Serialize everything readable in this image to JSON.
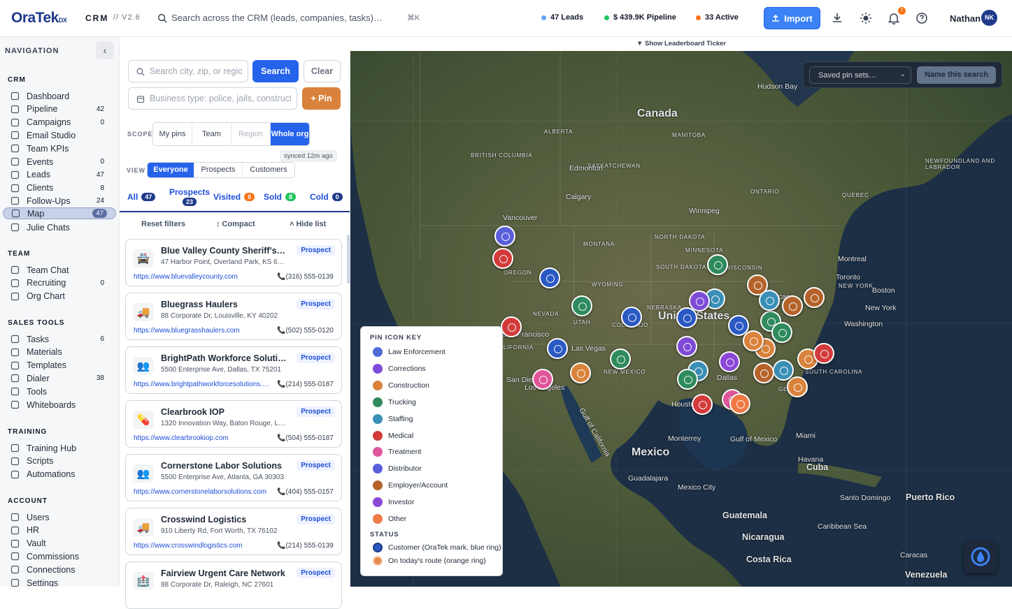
{
  "app": {
    "logo": "OraTek",
    "logo_suffix": "DX",
    "module": "CRM",
    "version": "// V2.6"
  },
  "topbar": {
    "search_placeholder": "Search across the CRM (leads, companies, tasks)…",
    "shortcut": "⌘K",
    "stats": [
      {
        "label": "47 Leads",
        "color": "#60a5fa"
      },
      {
        "label": "$ 439.9K Pipeline",
        "color": "#22c55e"
      },
      {
        "label": "33 Active",
        "color": "#f97316"
      }
    ],
    "import_label": "Import",
    "notifications": "7",
    "user_name": "Nathan",
    "user_initials": "NK"
  },
  "sidebar": {
    "title": "NAVIGATION",
    "sections": [
      {
        "title": "CRM",
        "items": [
          {
            "label": "Dashboard",
            "count": "",
            "icon": "grid-icon"
          },
          {
            "label": "Pipeline",
            "count": "42",
            "icon": "columns-icon"
          },
          {
            "label": "Campaigns",
            "count": "0",
            "icon": "send-icon"
          },
          {
            "label": "Email Studio",
            "count": "",
            "icon": "mail-icon"
          },
          {
            "label": "Team KPIs",
            "count": "",
            "icon": "users-icon"
          },
          {
            "label": "Events",
            "count": "0",
            "icon": "calendar-icon"
          },
          {
            "label": "Leads",
            "count": "47",
            "icon": "user-icon"
          },
          {
            "label": "Clients",
            "count": "8",
            "icon": "badge-icon"
          },
          {
            "label": "Follow-Ups",
            "count": "24",
            "icon": "clock-icon"
          },
          {
            "label": "Map",
            "count": "47",
            "icon": "map-pin-icon",
            "active": true
          },
          {
            "label": "Julie Chats",
            "count": "",
            "icon": "chat-icon"
          }
        ]
      },
      {
        "title": "TEAM",
        "items": [
          {
            "label": "Team Chat",
            "count": "",
            "icon": "chat-icon"
          },
          {
            "label": "Recruiting",
            "count": "0",
            "icon": "user-plus-icon"
          },
          {
            "label": "Org Chart",
            "count": "",
            "icon": "sitemap-icon"
          }
        ]
      },
      {
        "title": "SALES TOOLS",
        "items": [
          {
            "label": "Tasks",
            "count": "6",
            "icon": "check-icon"
          },
          {
            "label": "Materials",
            "count": "",
            "icon": "book-icon"
          },
          {
            "label": "Templates",
            "count": "",
            "icon": "mail-icon"
          },
          {
            "label": "Dialer",
            "count": "38",
            "icon": "phone-icon"
          },
          {
            "label": "Tools",
            "count": "",
            "icon": "square-icon"
          },
          {
            "label": "Whiteboards",
            "count": "",
            "icon": "board-icon"
          }
        ]
      },
      {
        "title": "TRAINING",
        "items": [
          {
            "label": "Training Hub",
            "count": "",
            "icon": "cap-icon"
          },
          {
            "label": "Scripts",
            "count": "",
            "icon": "file-icon"
          },
          {
            "label": "Automations",
            "count": "",
            "icon": "layers-icon"
          }
        ]
      },
      {
        "title": "ACCOUNT",
        "items": [
          {
            "label": "Users",
            "count": "",
            "icon": "user-icon"
          },
          {
            "label": "HR",
            "count": "",
            "icon": "doc-icon"
          },
          {
            "label": "Vault",
            "count": "",
            "icon": "key-icon"
          },
          {
            "label": "Commissions",
            "count": "",
            "icon": "dollar-icon"
          },
          {
            "label": "Connections",
            "count": "",
            "icon": "link-icon"
          },
          {
            "label": "Settings",
            "count": "",
            "icon": "gear-icon"
          }
        ]
      }
    ]
  },
  "panel": {
    "location_placeholder": "Search city, zip, or region",
    "search_label": "Search",
    "clear_label": "Clear",
    "business_placeholder": "Business type: police, jails, construction…",
    "pin_label": "+ Pin",
    "scope_label": "SCOPE",
    "scope": [
      {
        "label": "My pins",
        "state": "off"
      },
      {
        "label": "Team",
        "state": "off"
      },
      {
        "label": "Region",
        "state": "dim"
      },
      {
        "label": "Whole org",
        "state": "on"
      }
    ],
    "synced": "synced 12m ago",
    "view_label": "VIEW",
    "view": [
      {
        "label": "Everyone",
        "state": "on"
      },
      {
        "label": "Prospects",
        "state": "off"
      },
      {
        "label": "Customers",
        "state": "off"
      }
    ],
    "filters": [
      {
        "label": "All",
        "count": "47"
      },
      {
        "label": "Prospects",
        "count": "23"
      },
      {
        "label": "Visited",
        "count": "0",
        "color": "#f97316"
      },
      {
        "label": "Sold",
        "count": "8",
        "color": "#22c55e"
      },
      {
        "label": "Cold",
        "count": "0"
      }
    ],
    "reset_label": "Reset filters",
    "compact_label": "↕ Compact",
    "hide_label": "˄ Hide list",
    "cards": [
      {
        "name": "Blue Valley County Sheriff's Office",
        "address": "47 Harbor Point, Overland Park, KS 66210",
        "url": "https://www.bluevalleycounty.com",
        "phone": "(316) 555-0139",
        "tag": "Prospect",
        "icon": "police-car-icon",
        "glyph": "🚔"
      },
      {
        "name": "Bluegrass Haulers",
        "address": "88 Corporate Dr, Louisville, KY 40202",
        "url": "https://www.bluegrasshaulers.com",
        "phone": "(502) 555-0120",
        "tag": "Prospect",
        "icon": "truck-icon",
        "glyph": "🚚"
      },
      {
        "name": "BrightPath Workforce Solutions",
        "address": "5500 Enterprise Ave, Dallas, TX 75201",
        "url": "https://www.brightpathworkforcesolutions.com",
        "phone": "(214) 555-0187",
        "tag": "Prospect",
        "icon": "people-icon",
        "glyph": "👥"
      },
      {
        "name": "Clearbrook IOP",
        "address": "1320 Innovation Way, Baton Rouge, LA 70801",
        "url": "https://www.clearbrookiop.com",
        "phone": "(504) 555-0187",
        "tag": "Prospect",
        "icon": "pill-icon",
        "glyph": "💊"
      },
      {
        "name": "Cornerstone Labor Solutions",
        "address": "5500 Enterprise Ave, Atlanta, GA 30303",
        "url": "https://www.cornerstonelaborsolutions.com",
        "phone": "(404) 555-0157",
        "tag": "Prospect",
        "icon": "people-icon",
        "glyph": "👥"
      },
      {
        "name": "Crosswind Logistics",
        "address": "910 Liberty Rd, Fort Worth, TX 76102",
        "url": "https://www.crosswindlogistics.com",
        "phone": "(214) 555-0139",
        "tag": "Prospect",
        "icon": "truck-icon",
        "glyph": "🚚"
      },
      {
        "name": "Fairview Urgent Care Network",
        "address": "88 Corporate Dr, Raleigh, NC 27601",
        "url": "",
        "phone": "",
        "tag": "Prospect",
        "icon": "hospital-icon",
        "glyph": "🏥"
      }
    ]
  },
  "map": {
    "ticker_label": "▼ Show Leaderboard Ticker",
    "saved_placeholder": "Saved pin sets…",
    "name_search_label": "Name this search",
    "labels": [
      {
        "text": "Canada",
        "size": "big"
      },
      {
        "text": "Hudson Bay",
        "size": "small"
      },
      {
        "text": "ALBERTA",
        "size": "tiny"
      },
      {
        "text": "MANITOBA",
        "size": "tiny"
      },
      {
        "text": "BRITISH COLUMBIA",
        "size": "tiny"
      },
      {
        "text": "SASKATCHEWAN",
        "size": "tiny"
      },
      {
        "text": "Edmonton",
        "size": "small"
      },
      {
        "text": "NEWFOUNDLAND AND LABRADOR",
        "size": "tiny"
      },
      {
        "text": "Calgary",
        "size": "small"
      },
      {
        "text": "ONTARIO",
        "size": "tiny"
      },
      {
        "text": "QUEBEC",
        "size": "tiny"
      },
      {
        "text": "Winnipeg",
        "size": "small"
      },
      {
        "text": "Vancouver",
        "size": "small"
      },
      {
        "text": "Montreal",
        "size": "small"
      },
      {
        "text": "United States",
        "size": "big"
      },
      {
        "text": "Chicago",
        "size": "small"
      },
      {
        "text": "Toronto",
        "size": "small"
      },
      {
        "text": "NEW YORK",
        "size": "tiny"
      },
      {
        "text": "Boston",
        "size": "small"
      },
      {
        "text": "New York",
        "size": "small"
      },
      {
        "text": "Washington",
        "size": "small"
      },
      {
        "text": "Las Vegas",
        "size": "small"
      },
      {
        "text": "San Francisco",
        "size": "small"
      },
      {
        "text": "Los Angeles",
        "size": "small"
      },
      {
        "text": "San Diego",
        "size": "small"
      },
      {
        "text": "Dallas",
        "size": "small"
      },
      {
        "text": "Houston",
        "size": "small"
      },
      {
        "text": "Miami",
        "size": "small"
      },
      {
        "text": "Mexico",
        "size": "big"
      },
      {
        "text": "Monterrey",
        "size": "small"
      },
      {
        "text": "Guadalajara",
        "size": "small"
      },
      {
        "text": "Mexico City",
        "size": "small"
      },
      {
        "text": "Gulf of Mexico",
        "size": "small"
      },
      {
        "text": "Gulf of California",
        "size": "small"
      },
      {
        "text": "Havana",
        "size": "small"
      },
      {
        "text": "Cuba",
        "size": "medium"
      },
      {
        "text": "Santo Domingo",
        "size": "small"
      },
      {
        "text": "Puerto Rico",
        "size": "medium"
      },
      {
        "text": "Guatemala",
        "size": "medium"
      },
      {
        "text": "Nicaragua",
        "size": "medium"
      },
      {
        "text": "Costa Rica",
        "size": "medium"
      },
      {
        "text": "Caribbean Sea",
        "size": "small"
      },
      {
        "text": "Caracas",
        "size": "small"
      },
      {
        "text": "Venezuela",
        "size": "medium"
      },
      {
        "text": "OREGON",
        "size": "tiny"
      },
      {
        "text": "MONTANA",
        "size": "tiny"
      },
      {
        "text": "WYOMING",
        "size": "tiny"
      },
      {
        "text": "NEVADA",
        "size": "tiny"
      },
      {
        "text": "UTAH",
        "size": "tiny"
      },
      {
        "text": "COLORADO",
        "size": "tiny"
      },
      {
        "text": "CALIFORNIA",
        "size": "tiny"
      },
      {
        "text": "NEW MEXICO",
        "size": "tiny"
      },
      {
        "text": "NORTH DAKOTA",
        "size": "tiny"
      },
      {
        "text": "SOUTH DAKOTA",
        "size": "tiny"
      },
      {
        "text": "NEBRASKA",
        "size": "tiny"
      },
      {
        "text": "MINNESOTA",
        "size": "tiny"
      },
      {
        "text": "WISCONSIN",
        "size": "tiny"
      },
      {
        "text": "GEORGIA",
        "size": "tiny"
      },
      {
        "text": "SOUTH CAROLINA",
        "size": "tiny"
      }
    ],
    "legend": {
      "title": "PIN ICON KEY",
      "items": [
        {
          "label": "Law Enforcement",
          "color": "#4f6bd8"
        },
        {
          "label": "Corrections",
          "color": "#7e4ad6"
        },
        {
          "label": "Construction",
          "color": "#d9823b"
        },
        {
          "label": "Trucking",
          "color": "#2f8a5e"
        },
        {
          "label": "Staffing",
          "color": "#3a8fb7"
        },
        {
          "label": "Medical",
          "color": "#d33b3b"
        },
        {
          "label": "Treatment",
          "color": "#e0569a"
        },
        {
          "label": "Distributor",
          "color": "#5a5fdb"
        },
        {
          "label": "Employer/Account",
          "color": "#b5632b"
        },
        {
          "label": "Investor",
          "color": "#8b47d6"
        },
        {
          "label": "Other",
          "color": "#ef7a45"
        }
      ],
      "status_title": "STATUS",
      "status": [
        {
          "label": "Customer (OraTek mark, blue ring)",
          "color": "#2b59c3"
        },
        {
          "label": "On today's route (orange ring)",
          "color": "#e5894f"
        }
      ]
    },
    "pin_colors": [
      "#5a5fdb",
      "#d33b3b",
      "#2b59c3",
      "#2f8a5e",
      "#d33b3b",
      "#2b59c3",
      "#e0569a",
      "#d9823b",
      "#2f8a5e",
      "#2b59c3",
      "#2f8a5e",
      "#3a8fb7",
      "#b5632b",
      "#7e4ad6",
      "#2f8a5e",
      "#d33b3b",
      "#e0569a",
      "#ef7a45",
      "#3a8fb7",
      "#2b59c3",
      "#d9823b",
      "#d9823b",
      "#2f8a5e",
      "#3a8fb7",
      "#b5632b",
      "#b5632b",
      "#d9823b",
      "#d33b3b",
      "#7e4ad6",
      "#8b47d6",
      "#d9823b",
      "#3a8fb7",
      "#2b59c3",
      "#2f8a5e",
      "#b5632b"
    ]
  }
}
